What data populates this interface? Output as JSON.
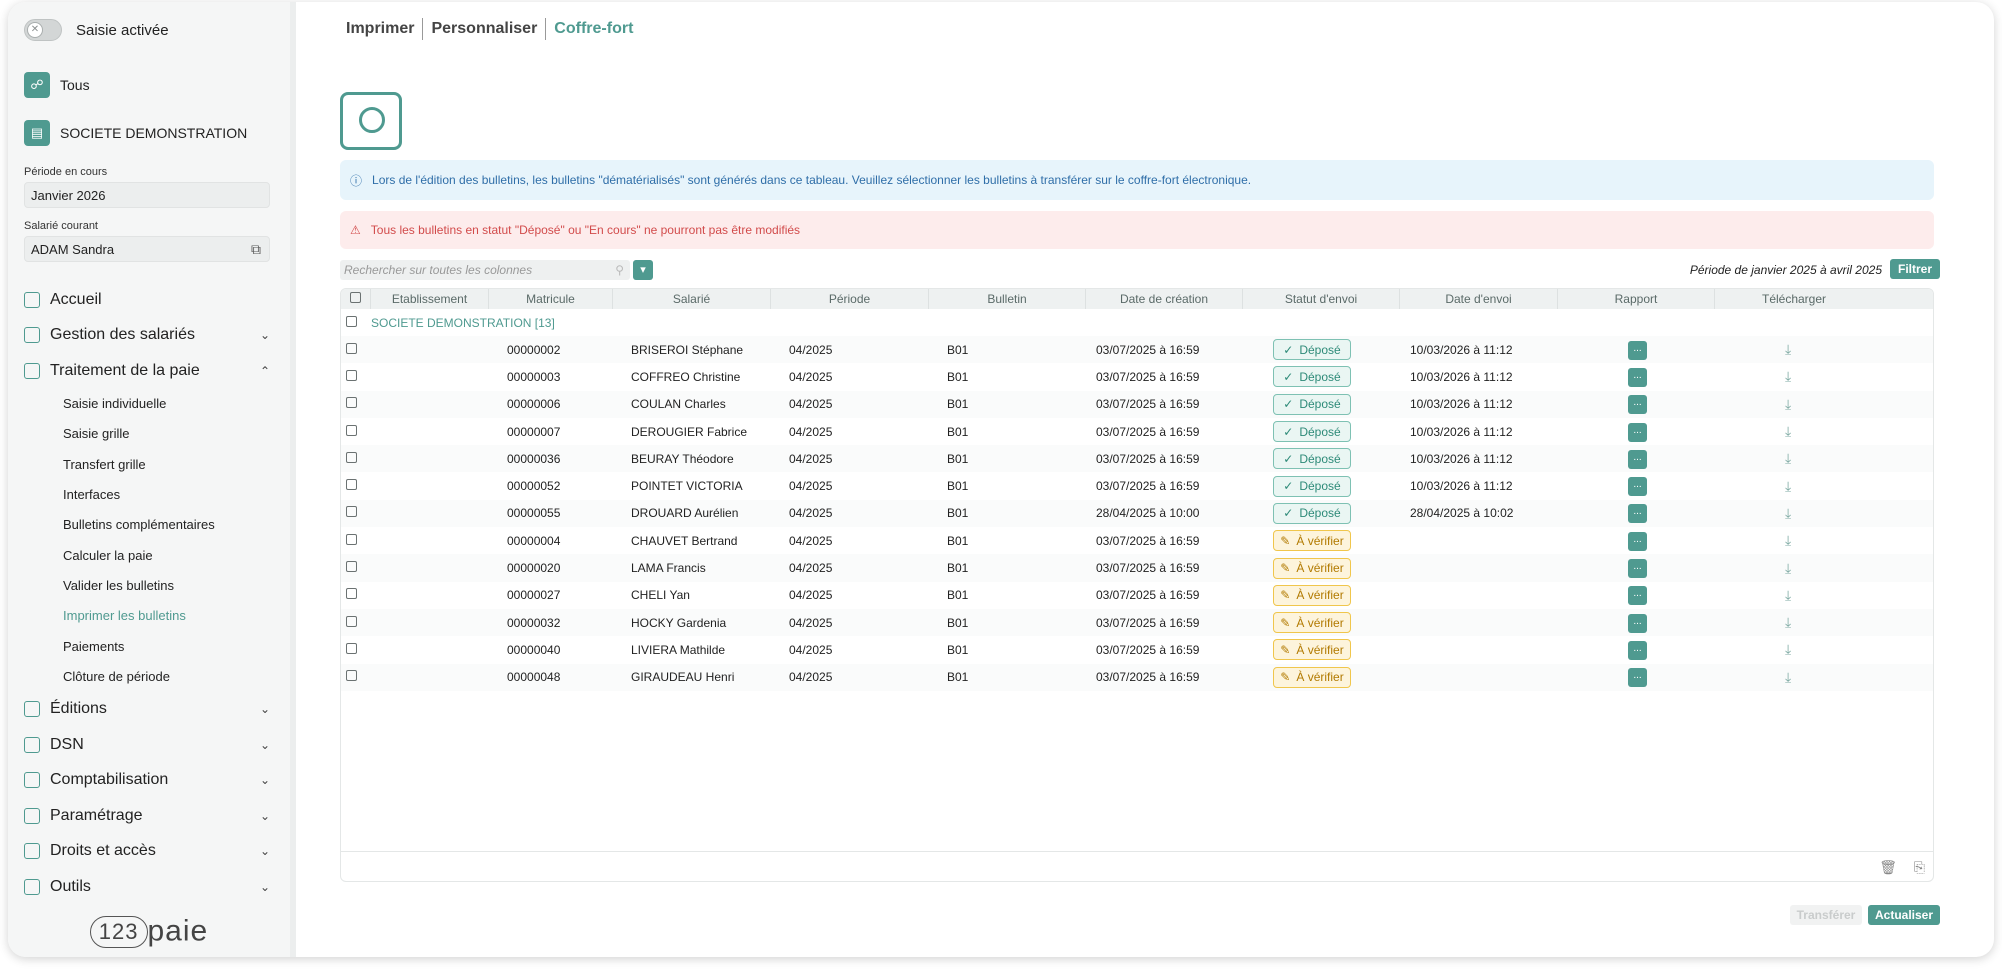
{
  "sidebar": {
    "toggle_label": "Saisie activée",
    "entities": [
      {
        "label": "Tous",
        "icon": "group-icon"
      },
      {
        "label": "SOCIETE DEMONSTRATION",
        "icon": "building-icon"
      }
    ],
    "period_label": "Période en cours",
    "period_value": "Janvier 2026",
    "employee_label": "Salarié courant",
    "employee_value": "ADAM Sandra",
    "nav": {
      "accueil": "Accueil",
      "gestion": "Gestion des salariés",
      "traitement": "Traitement de la paie",
      "sub": [
        "Saisie individuelle",
        "Saisie grille",
        "Transfert grille",
        "Interfaces",
        "Bulletins complémentaires",
        "Calculer la paie",
        "Valider les bulletins",
        "Imprimer les bulletins",
        "Paiements",
        "Clôture de période"
      ],
      "editions": "Éditions",
      "dsn": "DSN",
      "compta": "Comptabilisation",
      "param": "Paramétrage",
      "droits": "Droits et accès",
      "outils": "Outils"
    },
    "logo_num": "123",
    "logo_word": "paie"
  },
  "tabs": [
    "Imprimer",
    "Personnaliser",
    "Coffre-fort"
  ],
  "info_alert": "Lors de l'édition des bulletins, les bulletins \"dématérialisés\" sont générés dans ce tableau. Veuillez sélectionner les bulletins à transférer sur le coffre-fort électronique.",
  "warn_alert": "Tous les bulletins en statut \"Déposé\" ou \"En cours\" ne pourront pas être modifiés",
  "search_placeholder": "Rechercher sur toutes les colonnes",
  "period_range": "Période de janvier 2025 à avril 2025",
  "filter_label": "Filtrer",
  "columns": [
    "Etablissement",
    "Matricule",
    "Salarié",
    "Période",
    "Bulletin",
    "Date de création",
    "Statut d'envoi",
    "Date d'envoi",
    "Rapport",
    "Télécharger"
  ],
  "group_label": "SOCIETE DEMONSTRATION [13]",
  "rapport_label": "...",
  "rows": [
    {
      "matricule": "00000002",
      "salarie": "BRISEROI Stéphane",
      "periode": "04/2025",
      "bulletin": "B01",
      "creation": "03/07/2025 à 16:59",
      "statut": "Déposé",
      "envoi": "10/03/2026 à 11:12"
    },
    {
      "matricule": "00000003",
      "salarie": "COFFREO Christine",
      "periode": "04/2025",
      "bulletin": "B01",
      "creation": "03/07/2025 à 16:59",
      "statut": "Déposé",
      "envoi": "10/03/2026 à 11:12"
    },
    {
      "matricule": "00000006",
      "salarie": "COULAN Charles",
      "periode": "04/2025",
      "bulletin": "B01",
      "creation": "03/07/2025 à 16:59",
      "statut": "Déposé",
      "envoi": "10/03/2026 à 11:12"
    },
    {
      "matricule": "00000007",
      "salarie": "DEROUGIER Fabrice",
      "periode": "04/2025",
      "bulletin": "B01",
      "creation": "03/07/2025 à 16:59",
      "statut": "Déposé",
      "envoi": "10/03/2026 à 11:12"
    },
    {
      "matricule": "00000036",
      "salarie": "BEURAY Théodore",
      "periode": "04/2025",
      "bulletin": "B01",
      "creation": "03/07/2025 à 16:59",
      "statut": "Déposé",
      "envoi": "10/03/2026 à 11:12"
    },
    {
      "matricule": "00000052",
      "salarie": "POINTET VICTORIA",
      "periode": "04/2025",
      "bulletin": "B01",
      "creation": "03/07/2025 à 16:59",
      "statut": "Déposé",
      "envoi": "10/03/2026 à 11:12"
    },
    {
      "matricule": "00000055",
      "salarie": "DROUARD Aurélien",
      "periode": "04/2025",
      "bulletin": "B01",
      "creation": "28/04/2025 à 10:00",
      "statut": "Déposé",
      "envoi": "28/04/2025 à 10:02"
    },
    {
      "matricule": "00000004",
      "salarie": "CHAUVET Bertrand",
      "periode": "04/2025",
      "bulletin": "B01",
      "creation": "03/07/2025 à 16:59",
      "statut": "À vérifier",
      "envoi": ""
    },
    {
      "matricule": "00000020",
      "salarie": "LAMA Francis",
      "periode": "04/2025",
      "bulletin": "B01",
      "creation": "03/07/2025 à 16:59",
      "statut": "À vérifier",
      "envoi": ""
    },
    {
      "matricule": "00000027",
      "salarie": "CHELI Yan",
      "periode": "04/2025",
      "bulletin": "B01",
      "creation": "03/07/2025 à 16:59",
      "statut": "À vérifier",
      "envoi": ""
    },
    {
      "matricule": "00000032",
      "salarie": "HOCKY Gardenia",
      "periode": "04/2025",
      "bulletin": "B01",
      "creation": "03/07/2025 à 16:59",
      "statut": "À vérifier",
      "envoi": ""
    },
    {
      "matricule": "00000040",
      "salarie": "LIVIERA Mathilde",
      "periode": "04/2025",
      "bulletin": "B01",
      "creation": "03/07/2025 à 16:59",
      "statut": "À vérifier",
      "envoi": ""
    },
    {
      "matricule": "00000048",
      "salarie": "GIRAUDEAU Henri",
      "periode": "04/2025",
      "bulletin": "B01",
      "creation": "03/07/2025 à 16:59",
      "statut": "À vérifier",
      "envoi": ""
    }
  ],
  "btn_transfer": "Transférer",
  "btn_refresh": "Actualiser",
  "colors": {
    "accent": "#4f9a90",
    "ok": "#2d8a78",
    "warn": "#b27a00"
  }
}
